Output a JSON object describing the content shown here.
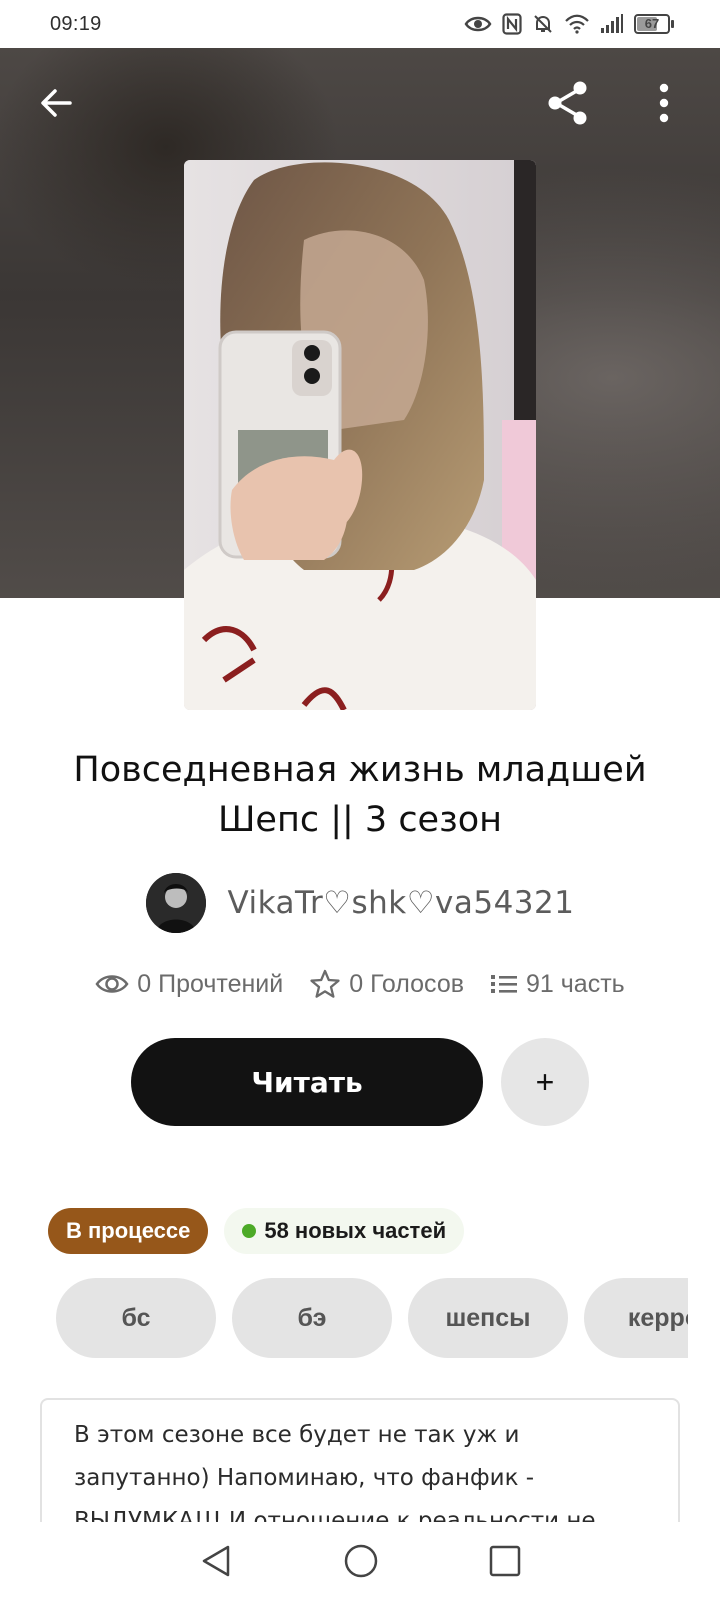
{
  "status_bar": {
    "time": "09:19",
    "battery": "67",
    "battery_level_percent": 67,
    "icons": [
      "eye-icon",
      "nfc-icon",
      "mute-icon",
      "wifi-icon",
      "signal-icon",
      "battery-icon"
    ]
  },
  "top_bar": {
    "icons": [
      "back-arrow-icon",
      "share-icon",
      "more-vertical-icon"
    ]
  },
  "story": {
    "title": "Повседневная жизнь младшей Шепс || 3 сезон",
    "author": "VikaTr♡shk♡va54321",
    "stats": {
      "reads": "0 Прочтений",
      "votes": "0 Голосов",
      "parts": "91 часть"
    },
    "read_label": "Читать",
    "add_label": "+",
    "status_badge": "В процессе",
    "new_parts_badge": "58 новых частей",
    "tags": [
      "бс",
      "бэ",
      "шепсы",
      "керро"
    ],
    "description": "В этом сезоне все будет не так уж и запутанно) Напоминаю, что фанфик - ВЫДУМКА!!! И отношение к реальности не"
  },
  "colors": {
    "status_badge_bg": "#96571a",
    "new_dot": "#4caa27",
    "read_button_bg": "#121212"
  },
  "nav_bar": {
    "icons": [
      "back-triangle-icon",
      "home-circle-icon",
      "recents-square-icon"
    ]
  }
}
